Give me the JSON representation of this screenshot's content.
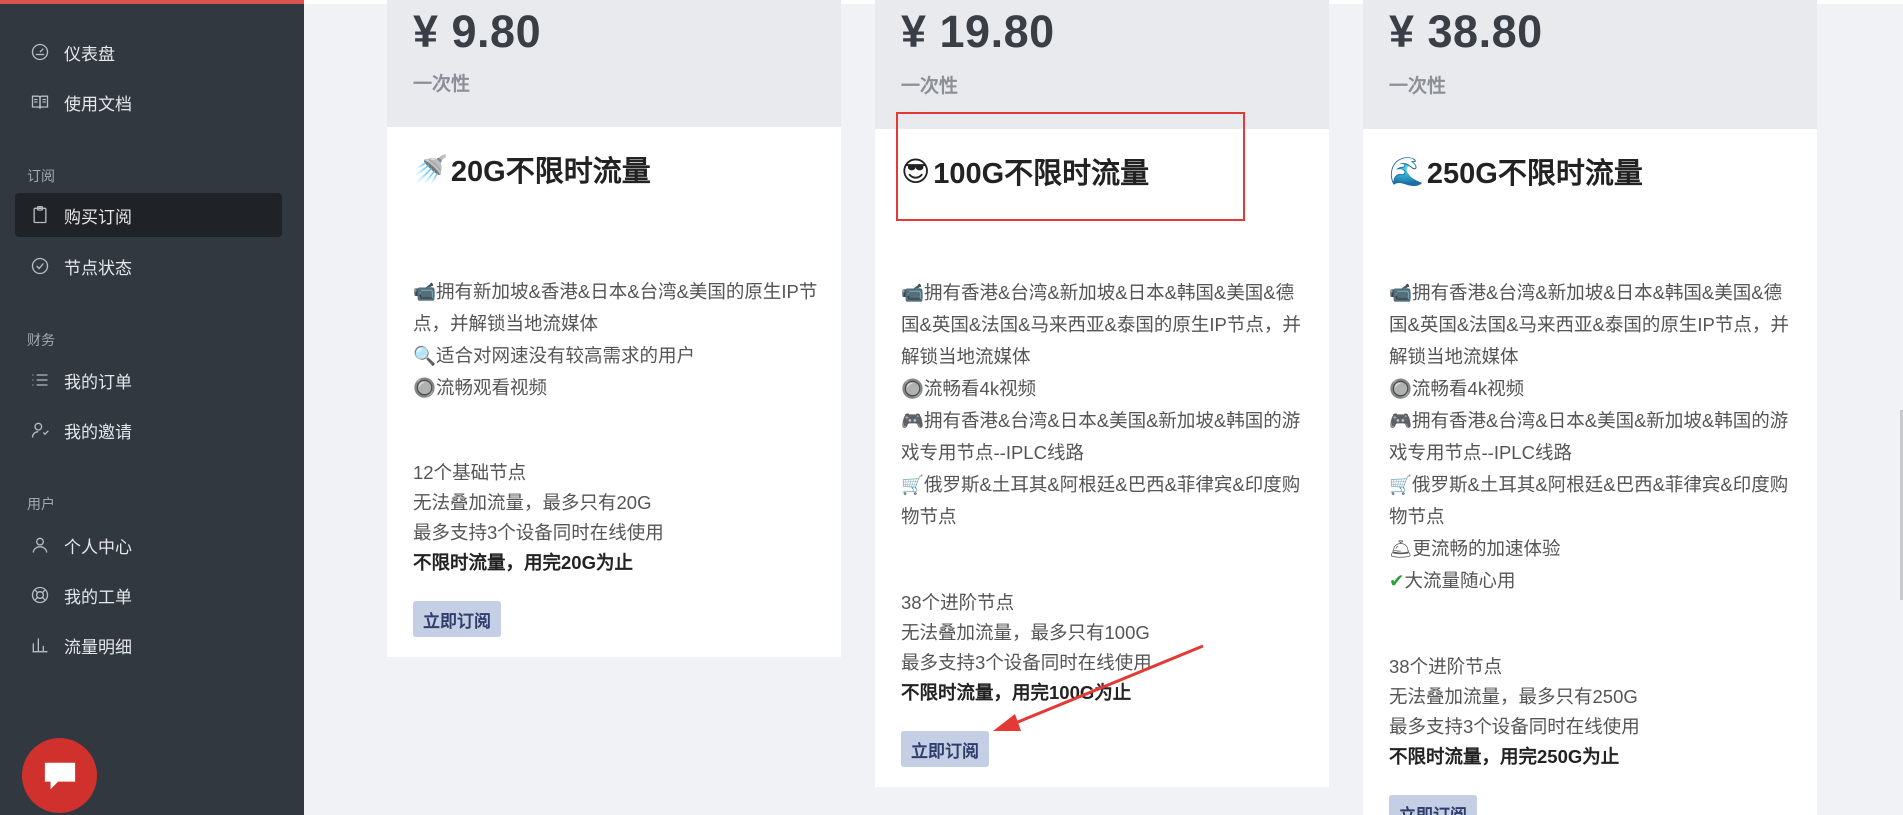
{
  "sidebar": {
    "items": [
      {
        "label": "仪表盘",
        "icon": "dashboard-icon"
      },
      {
        "label": "使用文档",
        "icon": "book-icon"
      },
      {
        "label": "购买订阅",
        "icon": "clipboard-icon"
      },
      {
        "label": "节点状态",
        "icon": "check-circle-icon"
      },
      {
        "label": "我的订单",
        "icon": "list-icon"
      },
      {
        "label": "我的邀请",
        "icon": "user-plus-icon"
      },
      {
        "label": "个人中心",
        "icon": "user-icon"
      },
      {
        "label": "我的工单",
        "icon": "lifebuoy-icon"
      },
      {
        "label": "流量明细",
        "icon": "bar-chart-icon"
      }
    ],
    "groups": {
      "subscribe": "订阅",
      "finance": "财务",
      "user": "用户"
    },
    "active": "购买订阅"
  },
  "plans": [
    {
      "price": "¥ 9.80",
      "period": "一次性",
      "title_emoji": "🚿",
      "title": "20G不限时流量",
      "desc": [
        {
          "emoji": "📹",
          "text": "拥有新加坡&香港&日本&台湾&美国的原生IP节点，并解锁当地流媒体"
        },
        {
          "emoji": "🔍",
          "text": "适合对网速没有较高需求的用户"
        },
        {
          "emoji": "🔘",
          "text": "流畅观看视频"
        }
      ],
      "info": [
        "12个基础节点",
        "无法叠加流量，最多只有20G",
        "最多支持3个设备同时在线使用"
      ],
      "info_strong": "不限时流量，用完20G为止",
      "button": "立即订阅"
    },
    {
      "price": "¥ 19.80",
      "period": "一次性",
      "title_emoji": "😎",
      "title": "100G不限时流量",
      "desc": [
        {
          "emoji": "📹",
          "text": "拥有香港&台湾&新加坡&日本&韩国&美国&德国&英国&法国&马来西亚&泰国的原生IP节点，并解锁当地流媒体"
        },
        {
          "emoji": "🔘",
          "text": "流畅看4k视频"
        },
        {
          "emoji": "🎮",
          "text": "拥有香港&台湾&日本&美国&新加坡&韩国的游戏专用节点--IPLC线路"
        },
        {
          "emoji": "🛒",
          "text": "俄罗斯&土耳其&阿根廷&巴西&菲律宾&印度购物节点"
        }
      ],
      "info": [
        "38个进阶节点",
        "无法叠加流量，最多只有100G",
        "最多支持3个设备同时在线使用"
      ],
      "info_strong": "不限时流量，用完100G为止",
      "button": "立即订阅"
    },
    {
      "price": "¥ 38.80",
      "period": "一次性",
      "title_emoji": "🌊",
      "title": "250G不限时流量",
      "desc": [
        {
          "emoji": "📹",
          "text": "拥有香港&台湾&新加坡&日本&韩国&美国&德国&英国&法国&马来西亚&泰国的原生IP节点，并解锁当地流媒体"
        },
        {
          "emoji": "🔘",
          "text": "流畅看4k视频"
        },
        {
          "emoji": "🎮",
          "text": "拥有香港&台湾&日本&美国&新加坡&韩国的游戏专用节点--IPLC线路"
        },
        {
          "emoji": "🛒",
          "text": "俄罗斯&土耳其&阿根廷&巴西&菲律宾&印度购物节点"
        },
        {
          "emoji": "🛎",
          "text": "更流畅的加速体验"
        },
        {
          "emoji": "✔",
          "text": "大流量随心用"
        }
      ],
      "info": [
        "38个进阶节点",
        "无法叠加流量，最多只有250G",
        "最多支持3个设备同时在线使用"
      ],
      "info_strong": "不限时流量，用完250G为止",
      "button": "立即订阅"
    }
  ],
  "colors": {
    "sidebar": "#313840",
    "accent": "#d0312d",
    "button": "#c4cee4",
    "highlight": "#e53935"
  }
}
